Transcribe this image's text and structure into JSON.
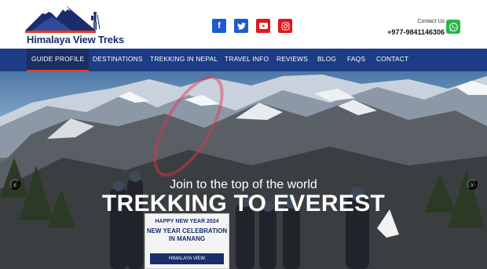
{
  "header": {
    "logo_text": "Himalaya View Treks",
    "contact_label": "Contact Us",
    "phone": "+977-9841146306"
  },
  "socials": [
    {
      "name": "facebook",
      "glyph": "f"
    },
    {
      "name": "twitter",
      "glyph": "t"
    },
    {
      "name": "youtube",
      "glyph": "▶"
    },
    {
      "name": "instagram",
      "glyph": "◎"
    }
  ],
  "nav": {
    "items": [
      "GUIDE PROFILE",
      "DESTINATIONS",
      "TREKKING IN NEPAL",
      "TRAVEL INFO",
      "REVIEWS",
      "BLOG",
      "FAQS",
      "CONTACT"
    ],
    "active_index": 0
  },
  "hero": {
    "subtitle": "Join to the top of the world",
    "title": "TREKKING TO EVEREST",
    "prev_glyph": "‹",
    "next_glyph": "›",
    "banner": {
      "line1": "HAPPY NEW YEAR 2024",
      "line2": "NEW YEAR CELEBRATION IN MANANG",
      "line3": "HIMALAYA VIEW"
    }
  },
  "colors": {
    "nav_bg": "#1c3d85",
    "accent": "#e63b1e",
    "brand": "#1a2c6b",
    "whatsapp": "#26b54a"
  }
}
